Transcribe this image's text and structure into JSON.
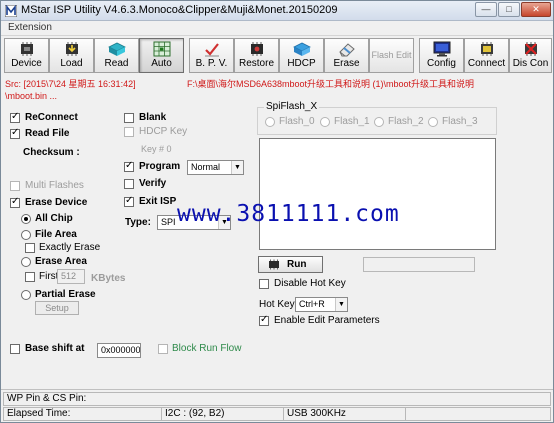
{
  "window": {
    "title": "MStar ISP Utility V4.6.3.Monoco&Clipper&Muji&Monet.20150209",
    "min_glyph": "—",
    "max_glyph": "□",
    "close_glyph": "✕"
  },
  "menu": {
    "extension": "Extension"
  },
  "toolbar": {
    "device": "Device",
    "load": "Load",
    "read": "Read",
    "auto": "Auto",
    "bpv": "B. P. V.",
    "restore": "Restore",
    "hdcp": "HDCP",
    "erase": "Erase",
    "flash_edit": "Flash Edit",
    "config": "Config",
    "connect": "Connect",
    "dis_con": "Dis Con"
  },
  "source": {
    "prefix": "Src: [2015\\7\\24 星期五 16:31:42]",
    "path": "F:\\桌面\\海尔MSD6A638mboot升级工具和说明 (1)\\mboot升级工具和说明",
    "path2": "\\mboot.bin ..."
  },
  "options": {
    "reconnect": "ReConnect",
    "read_file": "Read File",
    "checksum": "Checksum :",
    "multi_flashes": "Multi Flashes",
    "erase_device": "Erase Device",
    "all_chip": "All Chip",
    "file_area": "File Area",
    "exactly_erase": "Exactly Erase",
    "erase_area": "Erase Area",
    "first": "First",
    "first_value": "512",
    "kbytes": "KBytes",
    "partial_erase": "Partial Erase",
    "setup": "Setup",
    "blank": "Blank",
    "hdcp_key": "HDCP Key",
    "key_no": "Key # 0",
    "program": "Program",
    "program_mode": "Normal",
    "verify": "Verify",
    "exit_isp": "Exit ISP",
    "type_label": "Type:",
    "type_value": "SPI",
    "base_shift": "Base shift at",
    "base_shift_value": "0x000000",
    "block_run_flow": "Block Run Flow"
  },
  "spiflash": {
    "title": "SpiFlash_X",
    "flashes": [
      "Flash_0",
      "Flash_1",
      "Flash_2",
      "Flash_3"
    ]
  },
  "run": {
    "label": "Run",
    "disable_hot_key": "Disable Hot Key",
    "hot_key_label": "Hot Key",
    "hot_key_value": "Ctrl+R",
    "enable_edit": "Enable Edit Parameters"
  },
  "watermark": "www.3811111.com",
  "status": {
    "wp_pin": "WP Pin & CS Pin:",
    "elapsed": "Elapsed Time:",
    "i2c": "I2C : (92, B2)",
    "usb": "USB  300KHz"
  },
  "colors": {
    "source_text": "#d01818",
    "watermark": "#0a10b0",
    "block_run_flow": "#2e8a4a"
  }
}
